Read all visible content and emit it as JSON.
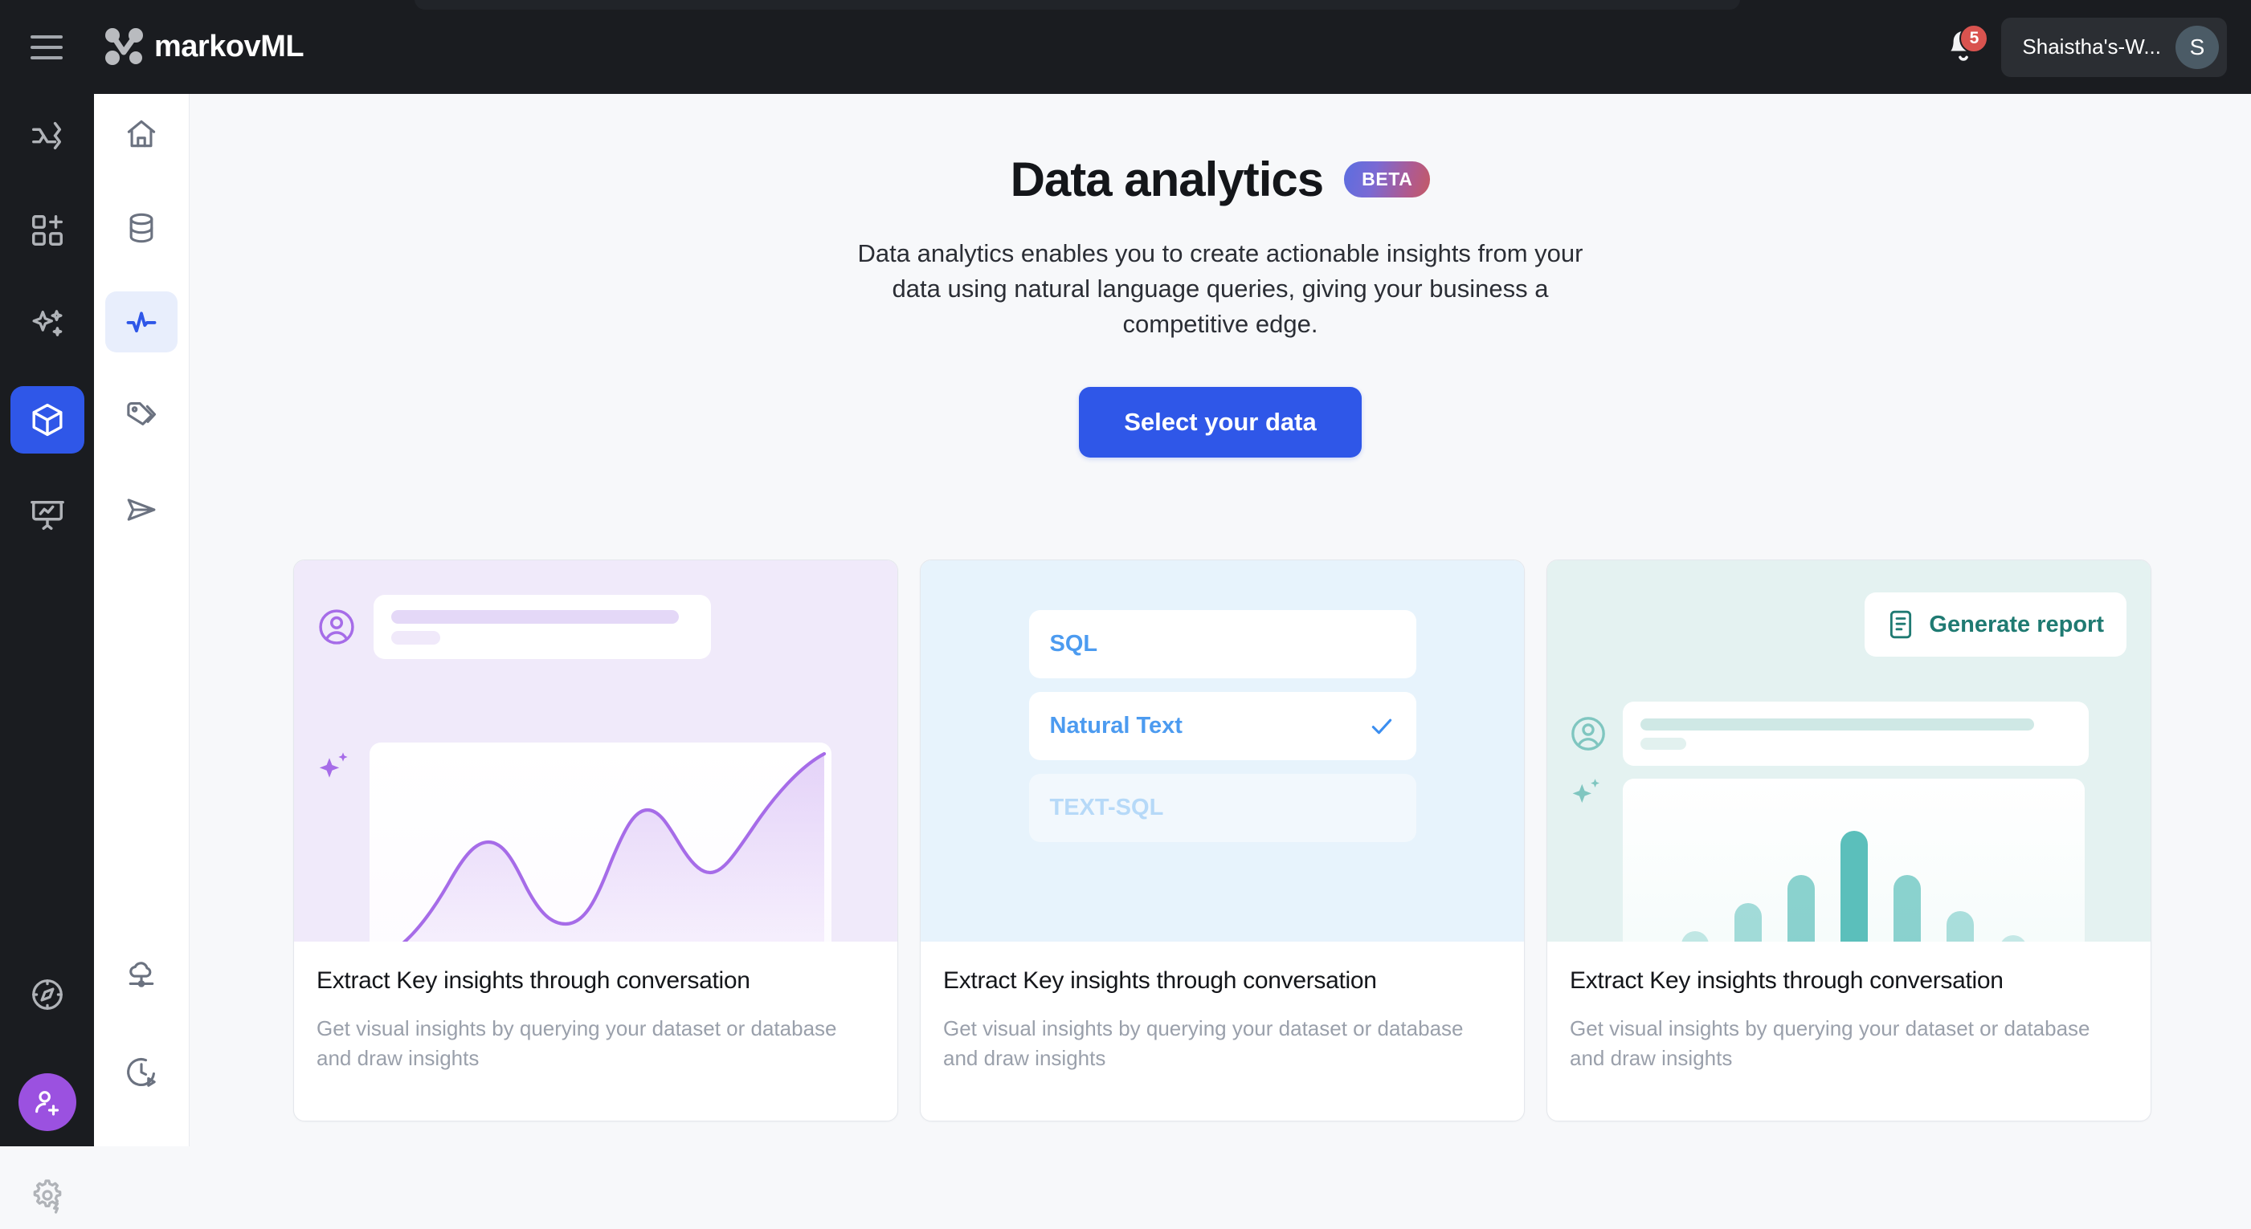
{
  "topbar": {
    "menu_icon": "hamburger-icon",
    "brand_name": "markovML",
    "brand_logo_icon": "markov-logo-icon",
    "notification_icon": "bell-icon",
    "notification_count": "5",
    "workspace_name": "Shaistha's-W...",
    "avatar_initial": "S"
  },
  "rail": {
    "items": [
      {
        "name": "workflows",
        "icon": "shuffle-arrows-icon",
        "active": false
      },
      {
        "name": "apps",
        "icon": "grid-plus-icon",
        "active": false
      },
      {
        "name": "ai-studio",
        "icon": "sparkles-icon",
        "active": false
      },
      {
        "name": "models",
        "icon": "cube-icon",
        "active": true
      },
      {
        "name": "presentations",
        "icon": "presentation-chart-icon",
        "active": false
      }
    ],
    "bottom_items": [
      {
        "name": "explore",
        "icon": "compass-icon"
      },
      {
        "name": "invite-user",
        "icon": "user-plus-icon"
      },
      {
        "name": "settings",
        "icon": "gear-bolt-icon"
      }
    ]
  },
  "subrail": {
    "items": [
      {
        "name": "home",
        "icon": "home-icon",
        "active": false
      },
      {
        "name": "datasets",
        "icon": "database-icon",
        "active": false
      },
      {
        "name": "data-analytics",
        "icon": "pulse-icon",
        "active": true
      },
      {
        "name": "tags",
        "icon": "tags-icon",
        "active": false
      },
      {
        "name": "send",
        "icon": "paper-plane-icon",
        "active": false
      }
    ],
    "bottom_items": [
      {
        "name": "cloud-connections",
        "icon": "cloud-network-icon"
      },
      {
        "name": "history",
        "icon": "clock-play-icon"
      }
    ]
  },
  "hero": {
    "title": "Data analytics",
    "badge": "BETA",
    "subtitle": "Data analytics enables you to create actionable insights from your data using natural language queries, giving your business a competitive edge.",
    "cta_label": "Select your data"
  },
  "cards": [
    {
      "name": "conversation-insights-card",
      "title": "Extract Key insights through conversation",
      "description": "Get visual insights by querying your dataset or database and draw insights",
      "accent": "#a66ce8",
      "background": "#f0eafa",
      "avatar_icon": "user-circle-icon",
      "sparkle_icon": "sparkles-icon",
      "visual_type": "line-chart"
    },
    {
      "name": "query-mode-card",
      "title": "Extract Key insights through conversation",
      "description": "Get visual insights by querying your dataset or database and draw insights",
      "accent": "#4c9bf0",
      "background": "#e7f3fc",
      "visual_type": "option-list",
      "options": [
        {
          "label": "SQL",
          "selected": false,
          "faded": false
        },
        {
          "label": "Natural Text",
          "selected": true,
          "faded": false,
          "check_icon": "check-icon"
        },
        {
          "label": "TEXT-SQL",
          "selected": false,
          "faded": true
        }
      ]
    },
    {
      "name": "generate-report-card",
      "title": "Extract Key insights through conversation",
      "description": "Get visual insights by querying your dataset or database and draw insights",
      "accent": "#1f7a72",
      "background": "#e4f2f1",
      "report_button_label": "Generate report",
      "report_icon": "document-list-icon",
      "avatar_icon": "user-circle-icon",
      "sparkle_icon": "sparkles-icon",
      "visual_type": "bar-chart"
    }
  ],
  "chart_data": [
    {
      "type": "area",
      "title": "",
      "xlabel": "",
      "ylabel": "",
      "series": [
        {
          "name": "insights-trend",
          "x": [
            0,
            1,
            2,
            3,
            4,
            5,
            6,
            7,
            8,
            9,
            10
          ],
          "values": [
            4,
            14,
            32,
            49,
            36,
            22,
            20,
            42,
            73,
            56,
            47,
            96
          ]
        }
      ],
      "color": "#a66ce8",
      "grid": false,
      "legend": "none",
      "ylim": [
        0,
        100
      ]
    },
    {
      "type": "bar",
      "title": "",
      "categories": [
        "1",
        "2",
        "3",
        "4",
        "5",
        "6",
        "7"
      ],
      "values": [
        24,
        38,
        52,
        74,
        52,
        34,
        22
      ],
      "opacities": [
        0.35,
        0.55,
        0.7,
        1.0,
        0.7,
        0.5,
        0.32
      ],
      "color": "#5bbfbb",
      "xlabel": "",
      "ylabel": "",
      "grid": false,
      "legend": "none",
      "ylim": [
        0,
        80
      ]
    }
  ]
}
